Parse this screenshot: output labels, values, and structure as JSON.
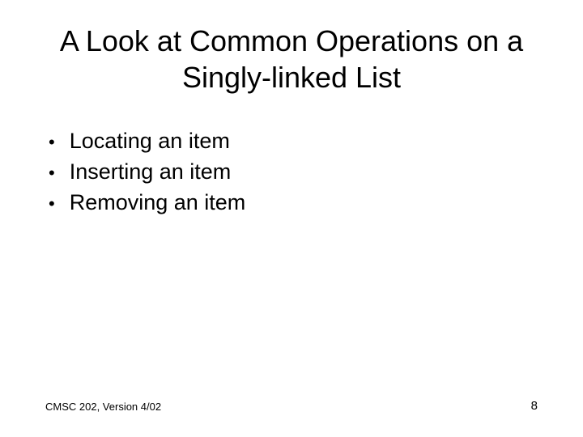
{
  "slide": {
    "title": "A Look at Common Operations on a Singly-linked List",
    "bullets": [
      "Locating an item",
      "Inserting an item",
      "Removing an item"
    ],
    "footer_left": "CMSC 202, Version 4/02",
    "page_number": "8"
  }
}
